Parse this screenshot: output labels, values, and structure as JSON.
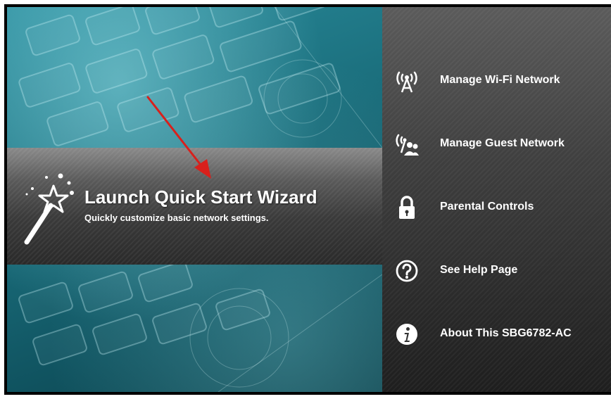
{
  "wizard": {
    "title": "Launch Quick Start Wizard",
    "subtitle": "Quickly customize basic network settings."
  },
  "menu": {
    "items": [
      {
        "label": "Manage Wi-Fi Network",
        "icon": "wifi-antenna-icon"
      },
      {
        "label": "Manage Guest Network",
        "icon": "guest-network-icon"
      },
      {
        "label": "Parental Controls",
        "icon": "lock-icon"
      },
      {
        "label": "See Help Page",
        "icon": "help-icon"
      },
      {
        "label": "About This SBG6782-AC",
        "icon": "info-icon"
      }
    ]
  },
  "colors": {
    "accent_arrow": "#d8201c",
    "background_teal": "#1b6f7d",
    "menu_panel": "#3a3a3a",
    "text": "#ffffff"
  }
}
